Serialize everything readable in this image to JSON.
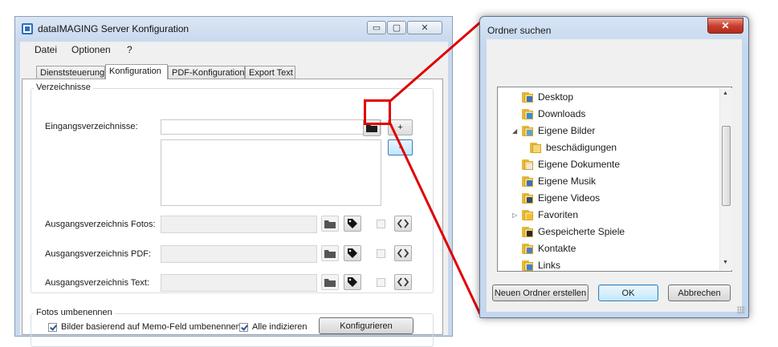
{
  "main_window": {
    "title": "dataIMAGING Server Konfiguration",
    "controls": {
      "minimize": "▭",
      "maximize": "▢",
      "close": "✕"
    },
    "menu": [
      "Datei",
      "Optionen",
      "?"
    ],
    "tabs": [
      "Dienststeuerung",
      "Konfiguration",
      "PDF-Konfiguration",
      "Export Text"
    ],
    "active_tab": "Konfiguration",
    "verzeichnisse": {
      "legend": "Verzeichnisse",
      "eingang_label": "Eingangsverzeichnisse:",
      "add_button": "+",
      "remove_button": "-",
      "fotos_label": "Ausgangsverzeichnis Fotos:",
      "pdf_label": "Ausgangsverzeichnis PDF:",
      "text_label": "Ausgangsverzeichnis Text:"
    },
    "fotos_umbenennen": {
      "legend": "Fotos umbenennen",
      "memo_checkbox": "Bilder basierend auf Memo-Feld umbenennen",
      "memo_checked": true,
      "index_checkbox": "Alle indizieren",
      "index_checked": true,
      "configure_button": "Konfigurieren"
    }
  },
  "folder_dialog": {
    "title": "Ordner suchen",
    "close": "✕",
    "tree": [
      {
        "label": "Desktop",
        "icon": "desktop-folder-icon",
        "badge": "#3a73c4"
      },
      {
        "label": "Downloads",
        "icon": "downloads-folder-icon",
        "badge": "#2f8de0"
      },
      {
        "label": "Eigene Bilder",
        "icon": "pictures-folder-icon",
        "badge": "#5aa0d8",
        "expanded": true
      },
      {
        "label": "beschädigungen",
        "icon": "folder-icon",
        "badge": "",
        "child": true
      },
      {
        "label": "Eigene Dokumente",
        "icon": "documents-folder-icon",
        "badge": "#e8e8e8"
      },
      {
        "label": "Eigene Musik",
        "icon": "music-folder-icon",
        "badge": "#3c6fb8"
      },
      {
        "label": "Eigene Videos",
        "icon": "videos-folder-icon",
        "badge": "#334a6e"
      },
      {
        "label": "Favoriten",
        "icon": "favorites-folder-icon",
        "badge": "#f0c030",
        "collapsed": true
      },
      {
        "label": "Gespeicherte Spiele",
        "icon": "saved-games-folder-icon",
        "badge": "#2a2a2a"
      },
      {
        "label": "Kontakte",
        "icon": "contacts-folder-icon",
        "badge": "#4f7fc0"
      },
      {
        "label": "Links",
        "icon": "links-folder-icon",
        "badge": "#3a80d0"
      }
    ],
    "buttons": {
      "new_folder": "Neuen Ordner erstellen",
      "ok": "OK",
      "cancel": "Abbrechen"
    }
  },
  "colors": {
    "highlight": "#e00000",
    "accent": "#3c7fb1"
  }
}
